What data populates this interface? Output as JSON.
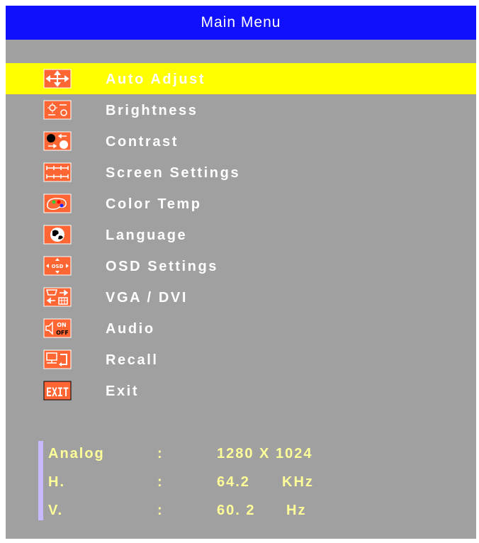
{
  "title": "Main Menu",
  "menu": {
    "items": [
      {
        "label": "Auto Adjust",
        "icon": "auto-adjust-icon",
        "selected": true
      },
      {
        "label": "Brightness",
        "icon": "brightness-icon",
        "selected": false
      },
      {
        "label": "Contrast",
        "icon": "contrast-icon",
        "selected": false
      },
      {
        "label": "Screen Settings",
        "icon": "screen-settings-icon",
        "selected": false
      },
      {
        "label": "Color Temp",
        "icon": "color-temp-icon",
        "selected": false
      },
      {
        "label": "Language",
        "icon": "language-icon",
        "selected": false
      },
      {
        "label": "OSD Settings",
        "icon": "osd-settings-icon",
        "selected": false
      },
      {
        "label": "VGA / DVI",
        "icon": "vga-dvi-icon",
        "selected": false
      },
      {
        "label": "Audio",
        "icon": "audio-icon",
        "selected": false
      },
      {
        "label": "Recall",
        "icon": "recall-icon",
        "selected": false
      },
      {
        "label": "Exit",
        "icon": "exit-icon",
        "selected": false
      }
    ]
  },
  "info": {
    "rows": [
      {
        "name": "Analog",
        "sep": ":",
        "value": "1280 X 1024",
        "unit": ""
      },
      {
        "name": "H.",
        "sep": ":",
        "value": "64.2",
        "unit": "KHz"
      },
      {
        "name": "V.",
        "sep": ":",
        "value": "60. 2",
        "unit": "Hz"
      }
    ]
  },
  "colors": {
    "title_bg": "#1010ff",
    "panel_bg": "#a0a0a0",
    "highlight": "#ffff00",
    "icon_bg": "#ff6633",
    "info_text": "#ffff99",
    "info_bar": "#c8b8ff"
  }
}
